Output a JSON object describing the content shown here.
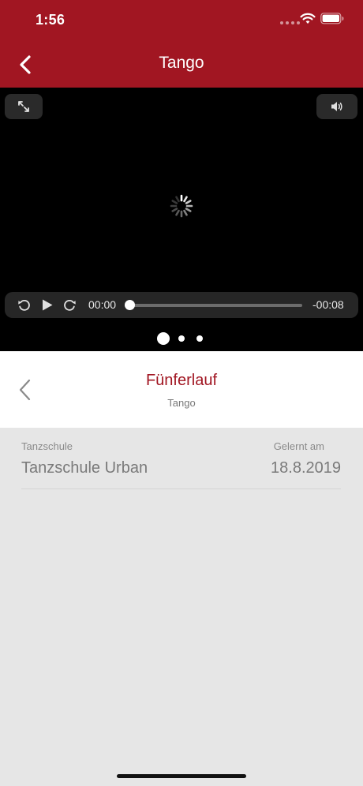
{
  "status_bar": {
    "time": "1:56"
  },
  "nav": {
    "title": "Tango"
  },
  "player": {
    "current_time": "00:00",
    "remaining_time": "-00:08",
    "progress": 0,
    "page_count": 3,
    "active_page": 1
  },
  "figure": {
    "name": "Fünferlauf",
    "dance": "Tango"
  },
  "details": {
    "school_label": "Tanzschule",
    "school_value": "Tanzschule Urban",
    "learned_label": "Gelernt am",
    "learned_value": "18.8.2019"
  },
  "colors": {
    "brand": "#a11622",
    "background": "#e6e6e6",
    "video_bg": "#000000"
  },
  "icons": [
    "back-chevron-icon",
    "wifi-icon",
    "battery-icon",
    "fullscreen-icon",
    "volume-icon",
    "loading-spinner-icon",
    "rewind-icon",
    "play-icon",
    "forward-icon",
    "previous-figure-icon"
  ]
}
